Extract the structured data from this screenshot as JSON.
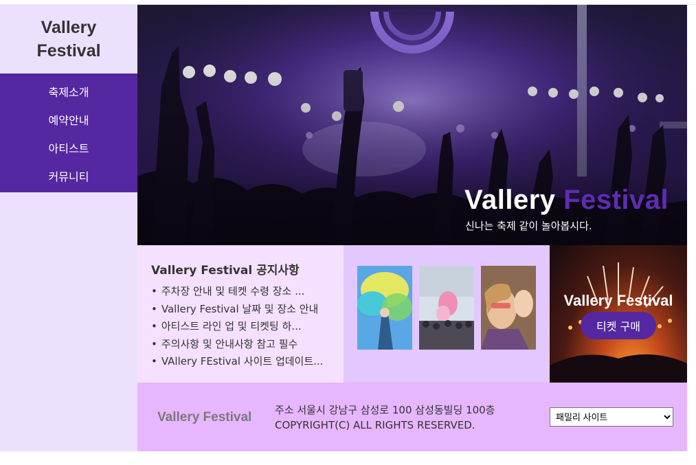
{
  "sidebar": {
    "logo_line1": "Vallery",
    "logo_line2": "Festival",
    "menu": [
      "축제소개",
      "예약안내",
      "아티스트",
      "커뮤니티"
    ]
  },
  "hero": {
    "title_main": "Vallery",
    "title_accent": "Festival",
    "subtitle": "신나는 축제 같이 놀아봅시다."
  },
  "notice": {
    "title": "Vallery Festival 공지사항",
    "items": [
      "주차장 안내 및 테켓 수령 장소 ...",
      "Vallery Festival 날짜 및 장소 안내",
      "아티스트 라인 업 및 티켓팅 하...",
      "주의사항 및 안내사항 참고 필수",
      "VAllery FEstival 사이트 업데이트..."
    ]
  },
  "ticket": {
    "title": "Vallery Festival",
    "button_label": "티켓 구매"
  },
  "footer": {
    "logo": "Vallery Festival",
    "address": "주소 서울시 강남구 삼성로 100 삼성동빌딩 100층",
    "copyright": "COPYRIGHT(C) ALL RIGHTS RESERVED.",
    "family_site": "패밀리 사이트"
  },
  "colors": {
    "brand_purple": "#5527a0",
    "sidebar_bg": "#ece0ff",
    "notice_bg": "#f5e0ff",
    "gallery_bg": "#e3c7ff",
    "footer_bg": "#e6b6ff"
  }
}
